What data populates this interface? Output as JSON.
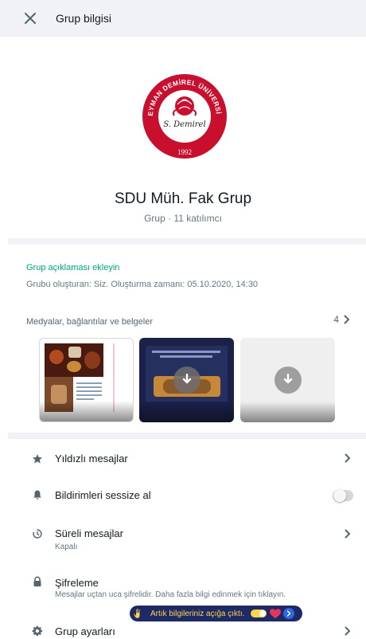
{
  "header": {
    "title": "Grup bilgisi",
    "close_icon": "close-icon"
  },
  "profile": {
    "logo": {
      "ring_text": "SÜLEYMAN DEMİREL ÜNİVERSİTESİ",
      "signature": "S. Demirel",
      "year": "1992"
    },
    "name": "SDU Müh. Fak Grup",
    "meta": "Grup · 11 katılımcı"
  },
  "description": {
    "add_label": "Grup açıklaması ekleyin",
    "creator": "Grubu oluşturan: Siz. Oluşturma zamanı: 05.10.2020, 14:30"
  },
  "media": {
    "label": "Medyalar, bağlantılar ve belgeler",
    "count": "4",
    "thumbs": [
      {
        "kind": "image",
        "icon": ""
      },
      {
        "kind": "image",
        "icon": "download-icon"
      },
      {
        "kind": "file",
        "icon": "download-icon"
      }
    ]
  },
  "settings": {
    "starred": {
      "label": "Yıldızlı mesajlar",
      "icon": "star-icon"
    },
    "mute": {
      "label": "Bildirimleri sessize al",
      "icon": "bell-icon",
      "enabled": false
    },
    "disappearing": {
      "label": "Süreli mesajlar",
      "sub": "Kapalı",
      "icon": "timer-icon"
    },
    "encryption": {
      "label": "Şifreleme",
      "sub": "Mesajlar uçtan uca şifrelidir. Daha fazla bilgi edinmek için tıklayın.",
      "icon": "lock-icon"
    },
    "group_settings": {
      "label": "Grup ayarları",
      "icon": "gear-icon"
    }
  },
  "banner": {
    "text": "Artık bilgileriniz açığa çıktı."
  },
  "colors": {
    "accent": "#00a884",
    "header_bg": "#f0f2f5",
    "logo_red": "#c8102e",
    "banner_bg": "#1e2a66"
  }
}
